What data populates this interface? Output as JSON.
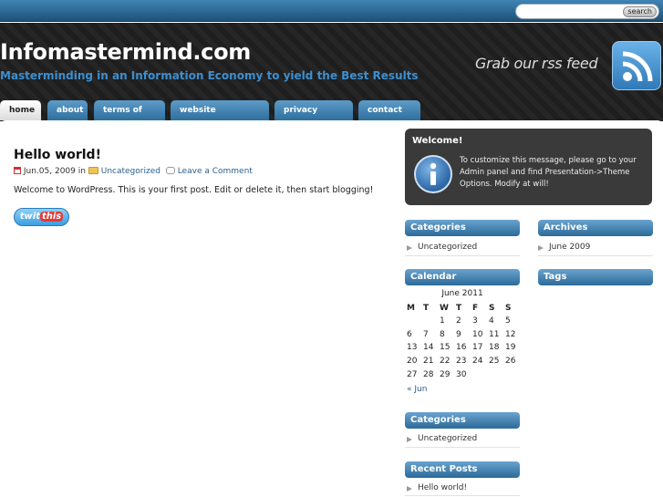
{
  "search": {
    "placeholder": "",
    "button_label": "search"
  },
  "header": {
    "site_title": "Infomastermind.com",
    "tagline": "Masterminding in an Information Economy to yield the Best Results",
    "rss_text": "Grab our rss feed"
  },
  "nav": {
    "tabs": [
      {
        "label": "home"
      },
      {
        "label": "about"
      },
      {
        "label": "terms of use"
      },
      {
        "label": "website disclaimer"
      },
      {
        "label": "privacy policy"
      },
      {
        "label": "contact us"
      }
    ]
  },
  "post": {
    "title": "Hello world!",
    "date": "Jun.05, 2009",
    "in_word": "in",
    "category": "Uncategorized",
    "comment_link": "Leave a Comment",
    "body": "Welcome to WordPress. This is your first post. Edit or delete it, then start blogging!",
    "twit_label_a": "twit",
    "twit_label_b": "this"
  },
  "welcome": {
    "title": "Welcome!",
    "text": "To customize this message, please go to your Admin panel and find Presentation->Theme Options. Modify at will!"
  },
  "sidebar": {
    "categories_title": "Categories",
    "categories_items": [
      "Uncategorized"
    ],
    "archives_title": "Archives",
    "archives_items": [
      "June 2009"
    ],
    "calendar_title": "Calendar",
    "tags_title": "Tags",
    "categories2_title": "Categories",
    "categories2_items": [
      "Uncategorized"
    ],
    "recent_title": "Recent Posts",
    "recent_items": [
      "Hello world!"
    ]
  },
  "calendar": {
    "caption": "June 2011",
    "weekdays": [
      "M",
      "T",
      "W",
      "T",
      "F",
      "S",
      "S"
    ],
    "weeks": [
      [
        "",
        "",
        "1",
        "2",
        "3",
        "4",
        "5"
      ],
      [
        "6",
        "7",
        "8",
        "9",
        "10",
        "11",
        "12"
      ],
      [
        "13",
        "14",
        "15",
        "16",
        "17",
        "18",
        "19"
      ],
      [
        "20",
        "21",
        "22",
        "23",
        "24",
        "25",
        "26"
      ],
      [
        "27",
        "28",
        "29",
        "30",
        "",
        "",
        ""
      ]
    ],
    "prev_link": "« Jun"
  },
  "colors": {
    "accent": "#2c6a98",
    "header_bg": "#1e1e1e",
    "tagline": "#3d8fd0"
  }
}
